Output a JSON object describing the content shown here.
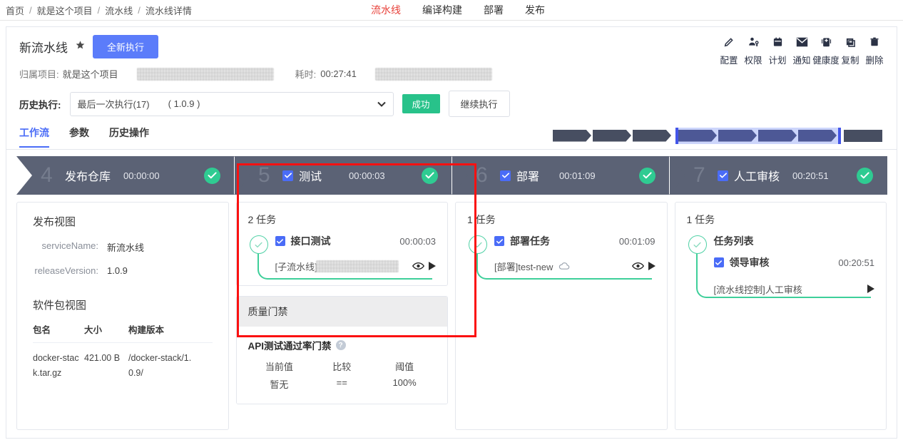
{
  "breadcrumb": [
    "首页",
    "就是这个项目",
    "流水线",
    "流水线详情"
  ],
  "topnav": [
    {
      "label": "流水线",
      "active": true
    },
    {
      "label": "编译构建",
      "active": false
    },
    {
      "label": "部署",
      "active": false
    },
    {
      "label": "发布",
      "active": false
    }
  ],
  "header": {
    "title": "新流水线",
    "star_icon": "star-icon",
    "run_button": "全新执行",
    "project_label": "归属项目:",
    "project_value": "就是这个项目",
    "duration_label": "耗时:",
    "duration_value": "00:27:41"
  },
  "toolbar": [
    {
      "icon": "pencil-icon",
      "label": "配置"
    },
    {
      "icon": "user-permission-icon",
      "label": "权限"
    },
    {
      "icon": "calendar-icon",
      "label": "计划"
    },
    {
      "icon": "envelope-icon",
      "label": "通知"
    },
    {
      "icon": "health-clipboard-icon",
      "label": "健康度"
    },
    {
      "icon": "copy-icon",
      "label": "复制"
    },
    {
      "icon": "trash-icon",
      "label": "删除"
    }
  ],
  "history": {
    "label": "历史执行:",
    "select_value": "最后一次执行(17)",
    "select_version": "( 1.0.9 )",
    "caret_icon": "chevron-down-icon",
    "status_badge": "成功",
    "continue_button": "继续执行"
  },
  "tabs": [
    {
      "label": "工作流",
      "active": true
    },
    {
      "label": "参数",
      "active": false
    },
    {
      "label": "历史操作",
      "active": false
    }
  ],
  "minimap": {
    "total_segments": 8,
    "selected_from": 4,
    "selected_to": 7
  },
  "stages": [
    {
      "num": "4",
      "name": "发布仓库",
      "time": "00:00:00",
      "checkbox": false,
      "status_icon": "check-circle-icon"
    },
    {
      "num": "5",
      "name": "测试",
      "time": "00:00:03",
      "checkbox": true,
      "status_icon": "check-circle-icon"
    },
    {
      "num": "6",
      "name": "部署",
      "time": "00:01:09",
      "checkbox": true,
      "status_icon": "check-circle-icon"
    },
    {
      "num": "7",
      "name": "人工审核",
      "time": "00:20:51",
      "checkbox": true,
      "status_icon": "check-circle-icon"
    }
  ],
  "col1": {
    "release_view_title": "发布视图",
    "service_name_key": "serviceName:",
    "service_name_value": "新流水线",
    "release_version_key": "releaseVersion:",
    "release_version_value": "1.0.9",
    "package_view_title": "软件包视图",
    "table_headers": [
      "包名",
      "大小",
      "构建版本"
    ],
    "rows": [
      {
        "name": "docker-stack.tar.gz",
        "size": "421.00 B",
        "version": "/docker-stack/1.0.9/"
      }
    ]
  },
  "col2": {
    "count": "2 任务",
    "task_name": "接口测试",
    "task_time": "00:00:03",
    "sub_prefix": "[子流水线]",
    "eye_icon": "eye-icon",
    "play_icon": "play-icon",
    "gate": {
      "title": "质量门禁",
      "name": "API测试通过率门禁",
      "help_icon": "help-icon",
      "headers": [
        "当前值",
        "比较",
        "阈值"
      ],
      "values": [
        "暂无",
        "==",
        "100%"
      ]
    }
  },
  "col3": {
    "count": "1 任务",
    "task_name": "部署任务",
    "task_time": "00:01:09",
    "sub_text": "[部署]test-new",
    "cloud_icon": "cloud-icon",
    "eye_icon": "eye-icon",
    "play_icon": "play-icon"
  },
  "col4": {
    "count": "1 任务",
    "group_title": "任务列表",
    "task_name": "领导审核",
    "task_time": "00:20:51",
    "sub_text": "[流水线控制]人工审核",
    "play_icon": "play-icon"
  },
  "colors": {
    "accent_blue": "#4a6cf7",
    "stage_bg": "#5b6275",
    "success_green": "#2fcb92",
    "badge_green": "#28c28a",
    "annotation_red": "#fb1111",
    "nav_active_red": "#e8413a"
  }
}
